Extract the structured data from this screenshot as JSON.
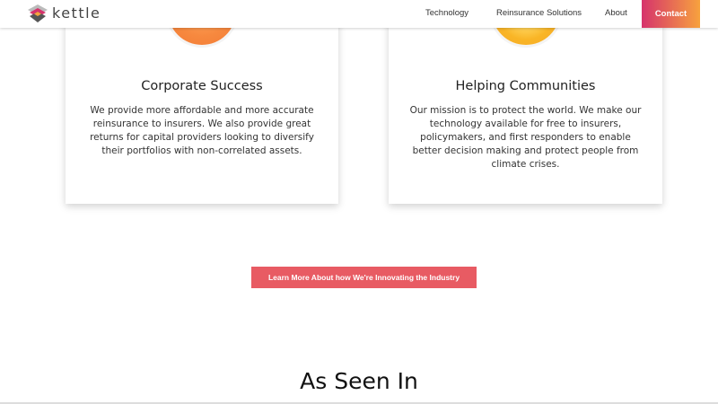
{
  "header": {
    "brand": "kettle",
    "nav": [
      {
        "label": "Technology"
      },
      {
        "label": "Reinsurance Solutions"
      },
      {
        "label": "About"
      }
    ],
    "contact_label": "Contact"
  },
  "cards": [
    {
      "title": "Corporate Success",
      "text": "We provide more affordable and more accurate reinsurance to insurers. We also provide great returns for capital providers looking to diversify their portfolios with non-correlated assets."
    },
    {
      "title": "Helping Communities",
      "text": "Our mission is to protect the world. We make our technology available for free to insurers, policymakers, and first responders to enable better decision making and protect people from climate crises."
    }
  ],
  "cta_label": "Learn More About how We're Innovating the Industry",
  "section_title": "As Seen In",
  "colors": {
    "accent": "#e85b63",
    "contact_start": "#d6336c",
    "contact_end": "#f7a23e"
  }
}
